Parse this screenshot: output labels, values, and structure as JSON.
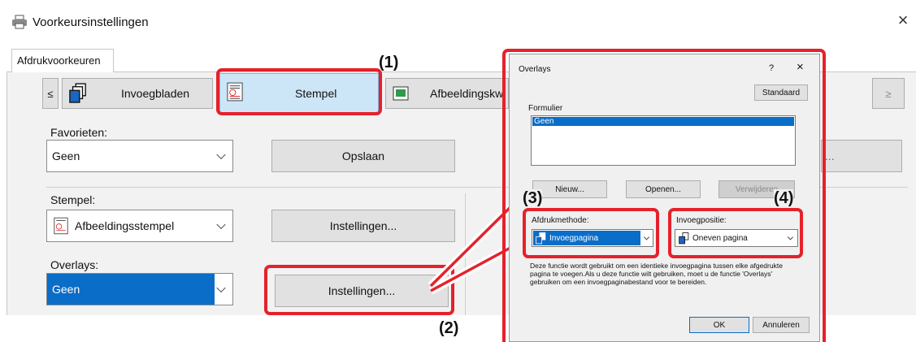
{
  "window": {
    "title": "Voorkeursinstellingen",
    "close_glyph": "×"
  },
  "tab_label": "Afdrukvoorkeuren",
  "nav": {
    "prev": "≤",
    "next": "≥",
    "invoegbladen": "Invoegbladen",
    "stempel": "Stempel",
    "afbeelding": "Afbeeldingskw"
  },
  "favorieten": {
    "label": "Favorieten:",
    "value": "Geen",
    "save": "Opslaan"
  },
  "stempel": {
    "label": "Stempel:",
    "value": "Afbeeldingsstempel",
    "settings": "Instellingen..."
  },
  "overlays": {
    "label": "Overlays:",
    "value": "Geen",
    "settings": "Instellingen..."
  },
  "partial_button": "...",
  "callouts": {
    "c1": "(1)",
    "c2": "(2)",
    "c3": "(3)",
    "c4": "(4)"
  },
  "dialog": {
    "title": "Overlays",
    "help": "?",
    "close": "×",
    "standaard": "Standaard",
    "formulier_label": "Formulier",
    "list_items": [
      "Geen"
    ],
    "nieuw": "Nieuw...",
    "openen": "Openen...",
    "verwijderen": "Verwijderen",
    "afdrukmethode_label": "Afdrukmethode:",
    "afdrukmethode_value": "Invoegpagina",
    "invoegpositie_label": "Invoegpositie:",
    "invoegpositie_value": "Oneven pagina",
    "description": "Deze functie wordt gebruikt om een identieke invoegpagina tussen elke afgedrukte pagina te voegen.Als u deze functie wilt gebruiken, moet u de functie 'Overlays' gebruiken om een invoegpaginabestand voor te bereiden.",
    "ok": "OK",
    "annuleren": "Annuleren"
  },
  "colors": {
    "highlight": "#0a6dc8",
    "selected_tile": "#cde6f7",
    "callout_red": "#e5212b"
  }
}
